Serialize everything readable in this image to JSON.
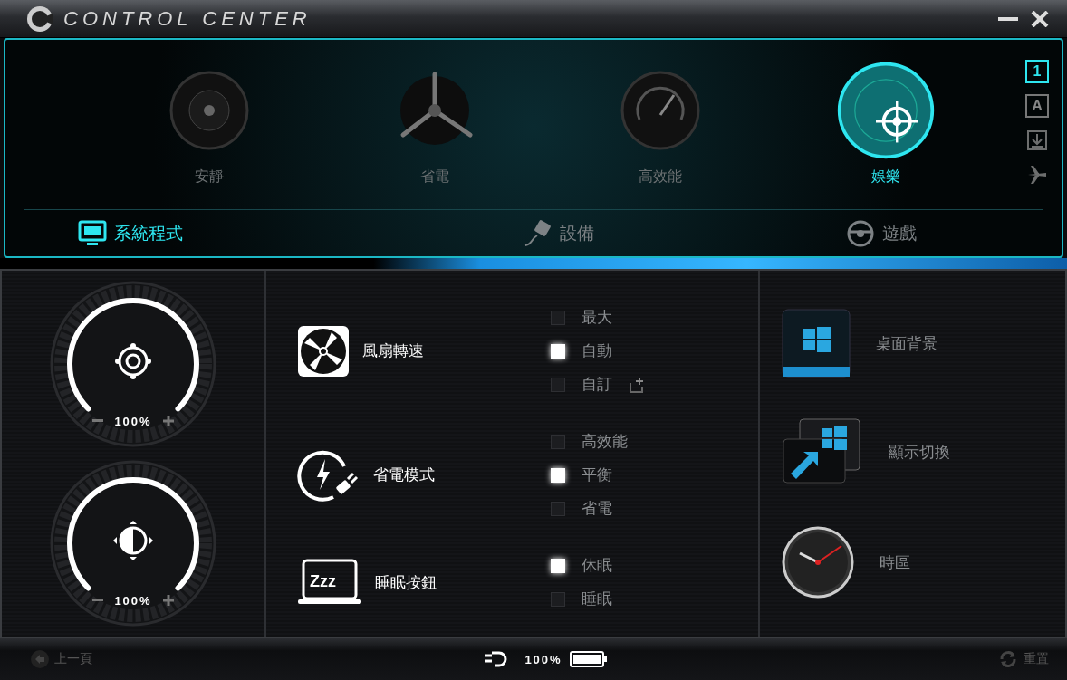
{
  "window": {
    "title": "CONTROL CENTER"
  },
  "modes": [
    {
      "label": "安靜",
      "kind": "speaker",
      "selected": false
    },
    {
      "label": "省電",
      "kind": "fan",
      "selected": false
    },
    {
      "label": "高效能",
      "kind": "gauge",
      "selected": false
    },
    {
      "label": "娛樂",
      "kind": "target",
      "selected": true
    }
  ],
  "side_buttons": [
    {
      "kind": "text",
      "label": "1",
      "selected": true
    },
    {
      "kind": "text",
      "label": "A",
      "selected": false
    },
    {
      "kind": "download",
      "selected": false
    },
    {
      "kind": "airplane",
      "selected": false
    }
  ],
  "tabs": [
    {
      "label": "系統程式",
      "kind": "monitor",
      "selected": true
    },
    {
      "label": "設備",
      "kind": "plug",
      "selected": false
    },
    {
      "label": "遊戲",
      "kind": "wheel",
      "selected": false
    }
  ],
  "dials": [
    {
      "kind": "volume",
      "reading": "100%",
      "level": 1
    },
    {
      "kind": "brightness",
      "reading": "100%",
      "level": 1
    }
  ],
  "settings": [
    {
      "label": "風扇轉速",
      "kind": "fan",
      "options": [
        {
          "label": "最大",
          "selected": false
        },
        {
          "label": "自動",
          "selected": true
        },
        {
          "label": "自訂",
          "selected": false,
          "kind": "custom"
        }
      ]
    },
    {
      "label": "省電模式",
      "kind": "power",
      "options": [
        {
          "label": "高效能",
          "selected": false
        },
        {
          "label": "平衡",
          "selected": true
        },
        {
          "label": "省電",
          "selected": false
        }
      ]
    },
    {
      "label": "睡眠按鈕",
      "kind": "sleep",
      "icon_text": "Zzz",
      "options": [
        {
          "label": "休眠",
          "selected": true
        },
        {
          "label": "睡眠",
          "selected": false
        }
      ]
    }
  ],
  "shortcuts": [
    {
      "label": "桌面背景",
      "kind": "wallpaper"
    },
    {
      "label": "顯示切換",
      "kind": "display"
    },
    {
      "label": "時區",
      "kind": "clock"
    }
  ],
  "footer": {
    "back": "上一頁",
    "battery": {
      "reading": "100%",
      "level": 1
    },
    "reset": "重置"
  }
}
